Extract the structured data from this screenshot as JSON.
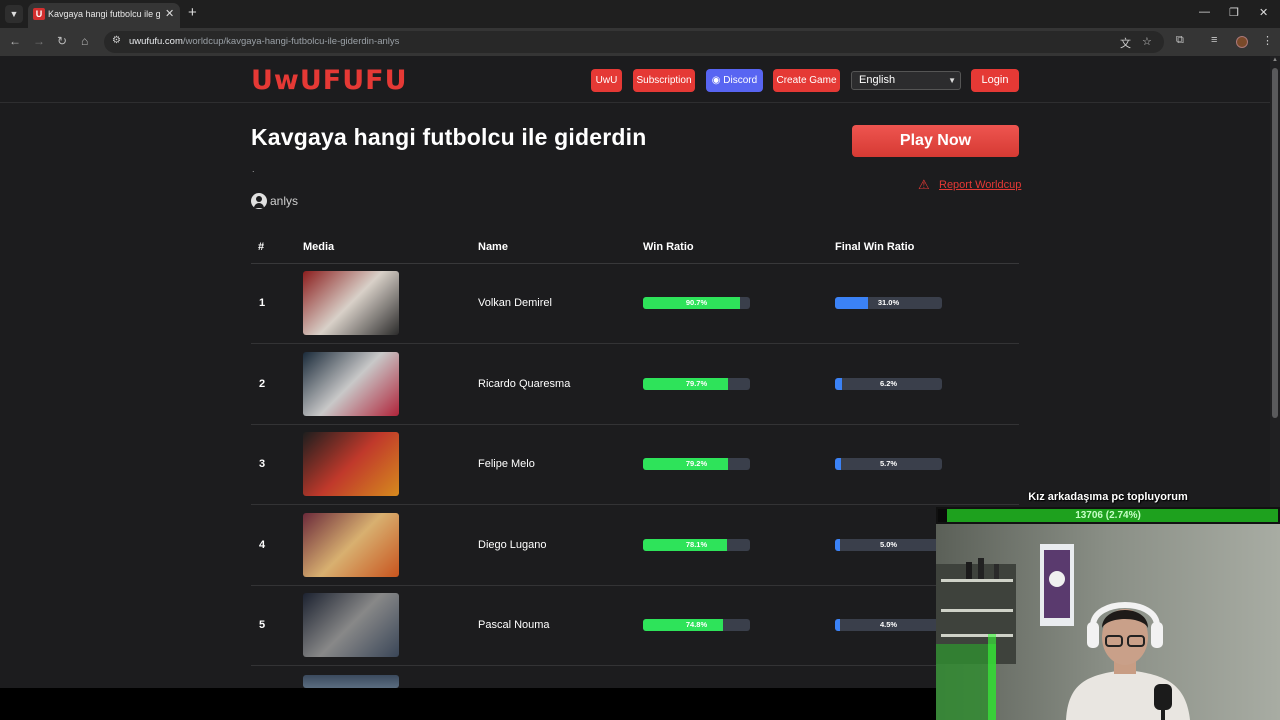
{
  "browser": {
    "tab_title": "Kavgaya hangi futbolcu ile giderdin",
    "favicon_letter": "U",
    "url_host": "uwufufu.com",
    "url_path": "/worldcup/kavgaya-hangi-futbolcu-ile-giderdin-anlys"
  },
  "header": {
    "logo": "UwUFUFU",
    "uwu_label": "UwU",
    "subscription_label": "Subscription",
    "discord_label": "Discord",
    "create_game_label": "Create Game",
    "language_selected": "English",
    "login_label": "Login"
  },
  "main": {
    "title": "Kavgaya hangi futbolcu ile giderdin",
    "description": ".",
    "author": "anlys",
    "play_label": "Play Now",
    "report_label": "Report Worldcup"
  },
  "table": {
    "headers": [
      "#",
      "Media",
      "Name",
      "Win Ratio",
      "Final Win Ratio"
    ],
    "rows": [
      {
        "rank": "1",
        "name": "Volkan Demirel",
        "win_ratio": "90.7%",
        "win_value": 0.907,
        "final_ratio": "31.0%",
        "final_value": 0.31
      },
      {
        "rank": "2",
        "name": "Ricardo Quaresma",
        "win_ratio": "79.7%",
        "win_value": 0.797,
        "final_ratio": "6.2%",
        "final_value": 0.062
      },
      {
        "rank": "3",
        "name": "Felipe Melo",
        "win_ratio": "79.2%",
        "win_value": 0.792,
        "final_ratio": "5.7%",
        "final_value": 0.057
      },
      {
        "rank": "4",
        "name": "Diego Lugano",
        "win_ratio": "78.1%",
        "win_value": 0.781,
        "final_ratio": "5.0%",
        "final_value": 0.05
      },
      {
        "rank": "5",
        "name": "Pascal Nouma",
        "win_ratio": "74.8%",
        "win_value": 0.748,
        "final_ratio": "4.5%",
        "final_value": 0.045
      }
    ]
  },
  "overlay": {
    "goal_title": "Kız arkadaşıma pc topluyorum",
    "goal_progress": "13706 (2.74%)",
    "goal_value": 0.0274
  },
  "colors": {
    "accent": "#e53935",
    "discord": "#5865f2",
    "win_bar": "#2ee35a",
    "final_bar": "#3b82f6",
    "goal_bar": "#1ea11e"
  }
}
